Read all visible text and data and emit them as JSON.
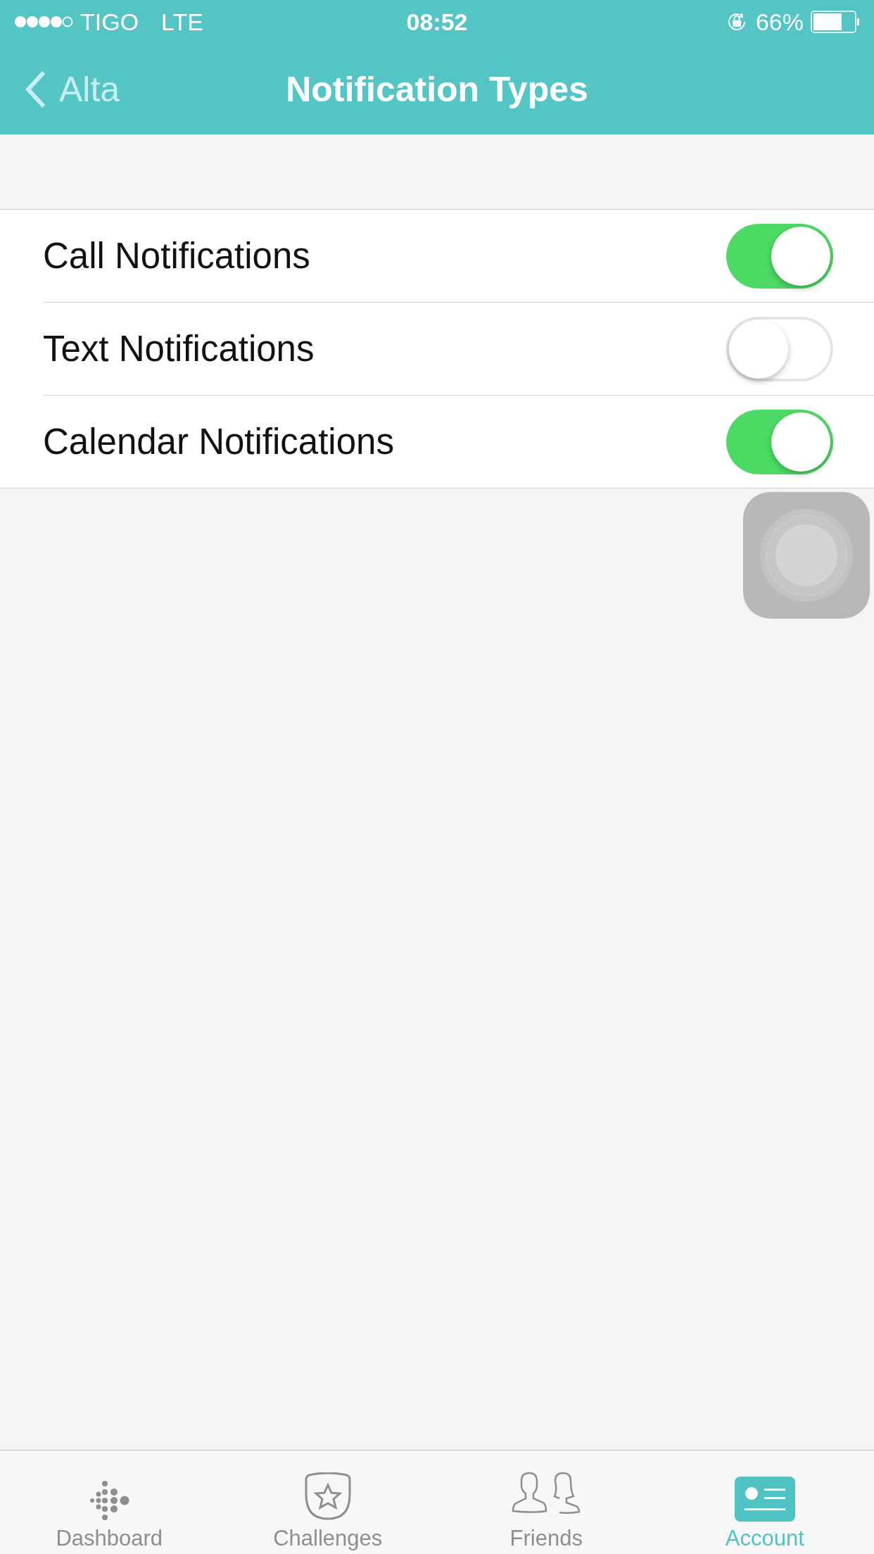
{
  "status_bar": {
    "carrier": "TIGO",
    "network": "LTE",
    "time": "08:52",
    "battery_percent": "66%"
  },
  "nav_bar": {
    "back_label": "Alta",
    "title": "Notification Types"
  },
  "settings": [
    {
      "label": "Call Notifications",
      "on": true
    },
    {
      "label": "Text Notifications",
      "on": false
    },
    {
      "label": "Calendar Notifications",
      "on": true
    }
  ],
  "tab_bar": [
    {
      "label": "Dashboard",
      "kind": "dashboard",
      "selected": false
    },
    {
      "label": "Challenges",
      "kind": "challenges",
      "selected": false
    },
    {
      "label": "Friends",
      "kind": "friends",
      "selected": false
    },
    {
      "label": "Account",
      "kind": "account",
      "selected": true
    }
  ]
}
